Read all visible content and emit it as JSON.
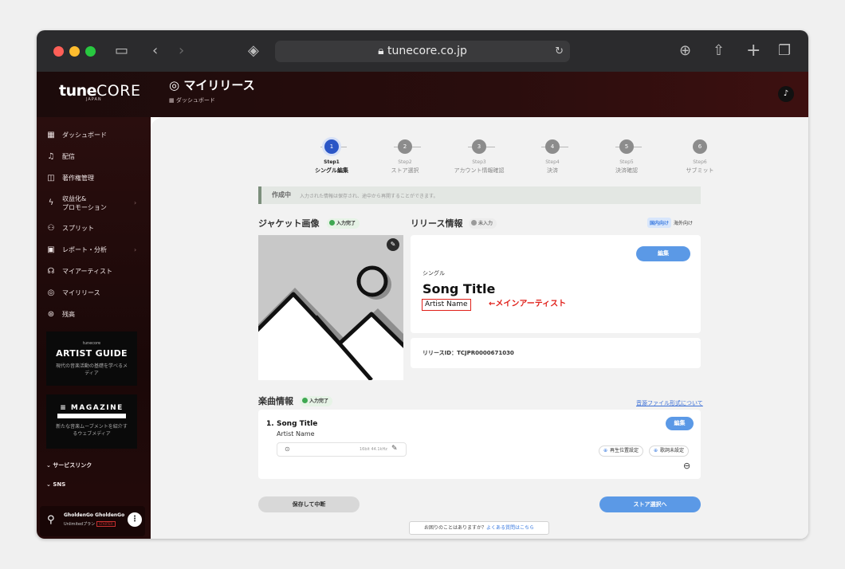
{
  "browser": {
    "url": "tunecore.co.jp",
    "colors": {
      "close": "#ff5f57",
      "minimize": "#febc2e",
      "zoom": "#28c840"
    }
  },
  "header": {
    "logo_main": "tune",
    "logo_core": "CORE",
    "logo_sub": "JAPAN",
    "title": "マイリリース",
    "breadcrumb": "ダッシュボード"
  },
  "sidebar": {
    "items": [
      {
        "label": "ダッシュボード",
        "icon": "dashboard-icon"
      },
      {
        "label": "配信",
        "icon": "music-note-icon"
      },
      {
        "label": "著作権管理",
        "icon": "book-icon"
      },
      {
        "label": "収益化&",
        "label2": "プロモーション",
        "icon": "bolt-icon"
      },
      {
        "label": "スプリット",
        "icon": "people-icon"
      },
      {
        "label": "レポート・分析",
        "icon": "report-icon"
      },
      {
        "label": "マイアーティスト",
        "icon": "artist-icon"
      },
      {
        "label": "マイリリース",
        "icon": "disc-icon"
      },
      {
        "label": "残高",
        "icon": "coin-icon"
      }
    ],
    "artist_guide": {
      "brand": "tunecore",
      "title": "ARTIST GUIDE",
      "desc": "現代の音楽活動の基礎を学べるメディア"
    },
    "magazine": {
      "title": "MAGAZINE",
      "desc": "新たな音楽ムーブメントを紹介するウェブメディア"
    },
    "service_links": "サービスリンク",
    "sns": "SNS",
    "user": {
      "name": "GholdenGo GholdenGo",
      "plan": "Unlimitedプラン",
      "tag": "STARTER"
    }
  },
  "stepper": {
    "steps": [
      {
        "num": "1",
        "label": "Step1",
        "name": "シングル編集",
        "active": true
      },
      {
        "num": "2",
        "label": "Step2",
        "name": "ストア選択"
      },
      {
        "num": "3",
        "label": "Step3",
        "name": "アカウント情報確認"
      },
      {
        "num": "4",
        "label": "Step4",
        "name": "決済"
      },
      {
        "num": "5",
        "label": "Step5",
        "name": "決済確認"
      },
      {
        "num": "6",
        "label": "Step6",
        "name": "サブミット"
      }
    ]
  },
  "notice": {
    "status": "作成中",
    "text": "入力された情報は保存され、途中から再開することができます。"
  },
  "jacket": {
    "title": "ジャケット画像",
    "badge": "入力完了"
  },
  "release": {
    "title": "リリース情報",
    "badge": "未入力",
    "region_domestic": "国内向け",
    "region_overseas": "海外向け",
    "edit": "編集",
    "type": "シングル",
    "song_title": "Song Title",
    "artist": "Artist Name",
    "annotation": "←メインアーティスト",
    "release_id": "リリースID：TCJPR0000671030"
  },
  "tracks": {
    "title": "楽曲情報",
    "badge": "入力完了",
    "format_link": "音源ファイル形式について",
    "items": [
      {
        "no": "1.",
        "title": "Song Title",
        "artist": "Artist Name",
        "format": "16bit 44.1kHz",
        "edit": "編集",
        "position": "再生位置設定",
        "lyrics": "歌詞未設定"
      }
    ]
  },
  "actions": {
    "save": "保存して中断",
    "next": "ストア選択へ"
  },
  "help": {
    "text": "お困りのことはありますか？",
    "link": "よくある質問はこちら"
  }
}
